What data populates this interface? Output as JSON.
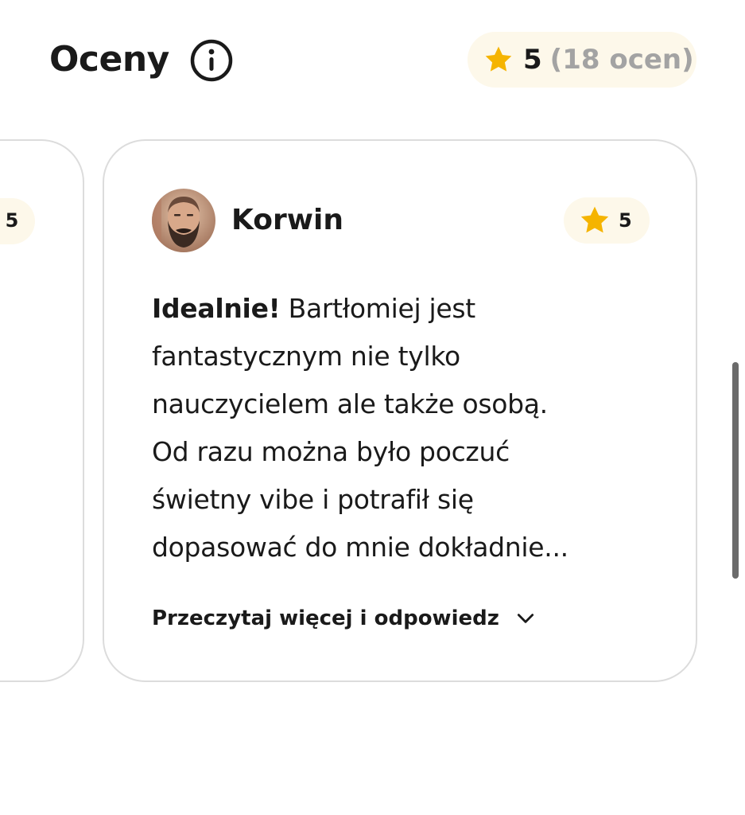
{
  "header": {
    "title": "Oceny",
    "info_icon": "info-circle-icon",
    "rating_summary": {
      "icon": "star-icon",
      "average": "5",
      "count": "(18 ocen)"
    }
  },
  "colors": {
    "star": "#f5b400",
    "pill_bg": "#fdf8ea",
    "muted": "#a3a3a3",
    "border": "#dcdcdc"
  },
  "previous_card": {
    "rating": "5"
  },
  "review": {
    "reviewer": "Korwin",
    "avatar_icon": "user-avatar",
    "rating": "5",
    "lead": "Idealnie!",
    "lines": [
      "Bartłomiej jest",
      "fantastycznym nie tylko",
      "nauczycielem ale także osobą.",
      "Od razu można było poczuć",
      "świetny vibe i potrafił się",
      "dopasować do mnie dokładnie..."
    ],
    "read_more": "Przeczytaj więcej i odpowiedz",
    "read_more_icon": "chevron-down-icon"
  }
}
